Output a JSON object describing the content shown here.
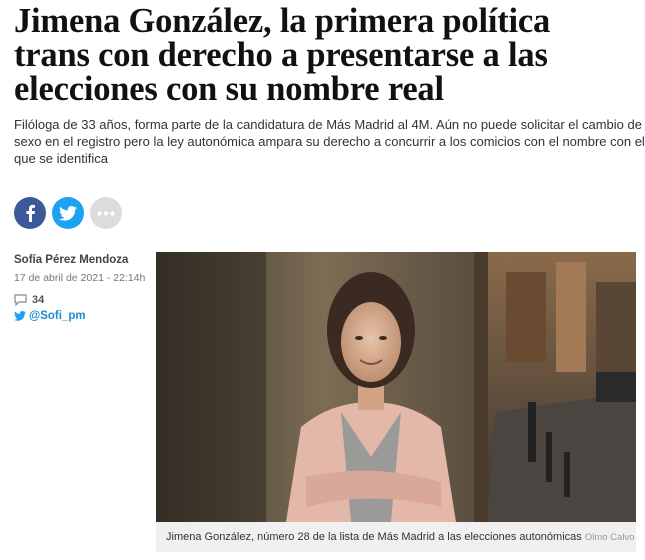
{
  "article": {
    "headline_lines": [
      "Jimena González, la primera política",
      "trans con derecho a presentarse a las",
      "elecciones con su nombre real"
    ],
    "subtitle_lines": [
      "Filóloga de 33 años, forma parte de la candidatura de Más Madrid al 4M. Aún no puede solicitar el cambio de",
      "sexo en el registro pero la ley autonómica ampara su derecho a concurrir a los comicios con el nombre con el",
      "que se identifica"
    ]
  },
  "share": {
    "facebook_icon": "facebook-icon",
    "twitter_icon": "twitter-icon",
    "more_icon": "more-dots-icon",
    "colors": {
      "facebook": "#3b5998",
      "twitter": "#1da1f2",
      "more": "#dcdcdc"
    }
  },
  "byline": {
    "author": "Sofía Pérez Mendoza",
    "date": "17 de abril de 2021 - 22:14h",
    "comments_count": "34",
    "twitter_handle": "@Sofi_pm"
  },
  "photo": {
    "caption": "Jimena González, número 28 de la lista de Más Madrid a las elecciones autonómicas",
    "credit": "Olmo Calvo"
  }
}
